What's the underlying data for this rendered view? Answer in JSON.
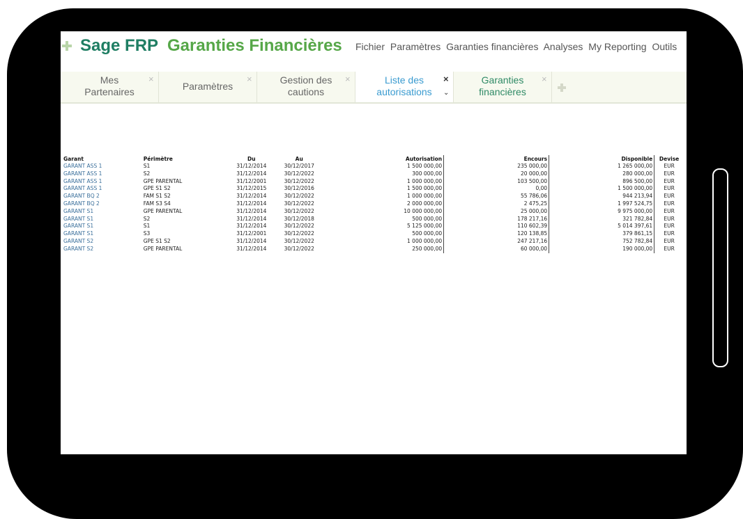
{
  "header": {
    "brand": "Sage FRP",
    "app_name": "Garanties Financières",
    "menu": [
      "Fichier",
      "Paramètres",
      "Garanties financières",
      "Analyses",
      "My Reporting",
      "Outils"
    ]
  },
  "tabs": [
    {
      "label1": "Mes",
      "label2": "Partenaires",
      "close": "×"
    },
    {
      "label1": "Paramètres",
      "label2": "",
      "close": "×"
    },
    {
      "label1": "Gestion des",
      "label2": "cautions",
      "close": "×"
    },
    {
      "label1": "Liste des",
      "label2": "autorisations",
      "close": "×",
      "chevron": "⌄"
    },
    {
      "label1": "Garanties",
      "label2": "financières",
      "close": "×"
    }
  ],
  "table": {
    "headers": {
      "garant": "Garant",
      "perimetre": "Périmètre",
      "du": "Du",
      "au": "Au",
      "autorisation": "Autorisation",
      "encours": "Encours",
      "disponible": "Disponible",
      "devise": "Devise"
    },
    "rows": [
      [
        "GARANT ASS 1",
        "S1",
        "31/12/2014",
        "30/12/2017",
        "1 500 000,00",
        "235 000,00",
        "1 265 000,00",
        "EUR"
      ],
      [
        "GARANT ASS 1",
        "S2",
        "31/12/2014",
        "30/12/2022",
        "300 000,00",
        "20 000,00",
        "280 000,00",
        "EUR"
      ],
      [
        "GARANT ASS 1",
        "GPE PARENTAL",
        "31/12/2001",
        "30/12/2022",
        "1 000 000,00",
        "103 500,00",
        "896 500,00",
        "EUR"
      ],
      [
        "GARANT ASS 1",
        "GPE S1 S2",
        "31/12/2015",
        "30/12/2016",
        "1 500 000,00",
        "0,00",
        "1 500 000,00",
        "EUR"
      ],
      [
        "GARANT BQ 2",
        "FAM S1 S2",
        "31/12/2014",
        "30/12/2022",
        "1 000 000,00",
        "55 786,06",
        "944 213,94",
        "EUR"
      ],
      [
        "GARANT BQ 2",
        "FAM S3 S4",
        "31/12/2014",
        "30/12/2022",
        "2 000 000,00",
        "2 475,25",
        "1 997 524,75",
        "EUR"
      ],
      [
        "GARANT S1",
        "GPE PARENTAL",
        "31/12/2014",
        "30/12/2022",
        "10 000 000,00",
        "25 000,00",
        "9 975 000,00",
        "EUR"
      ],
      [
        "GARANT S1",
        "S2",
        "31/12/2014",
        "30/12/2018",
        "500 000,00",
        "178 217,16",
        "321 782,84",
        "EUR"
      ],
      [
        "GARANT S1",
        "S1",
        "31/12/2014",
        "30/12/2022",
        "5 125 000,00",
        "110 602,39",
        "5 014 397,61",
        "EUR"
      ],
      [
        "GARANT S1",
        "S3",
        "31/12/2001",
        "30/12/2022",
        "500 000,00",
        "120 138,85",
        "379 861,15",
        "EUR"
      ],
      [
        "GARANT S2",
        "GPE S1 S2",
        "31/12/2014",
        "30/12/2022",
        "1 000 000,00",
        "247 217,16",
        "752 782,84",
        "EUR"
      ],
      [
        "GARANT S2",
        "GPE PARENTAL",
        "31/12/2014",
        "30/12/2022",
        "250 000,00",
        "60 000,00",
        "190 000,00",
        "EUR"
      ]
    ]
  },
  "colors": {
    "brand": "#1f7e63",
    "app": "#56a748",
    "active_tab": "#3a9bd0",
    "garant_link": "#3a6f9b"
  }
}
